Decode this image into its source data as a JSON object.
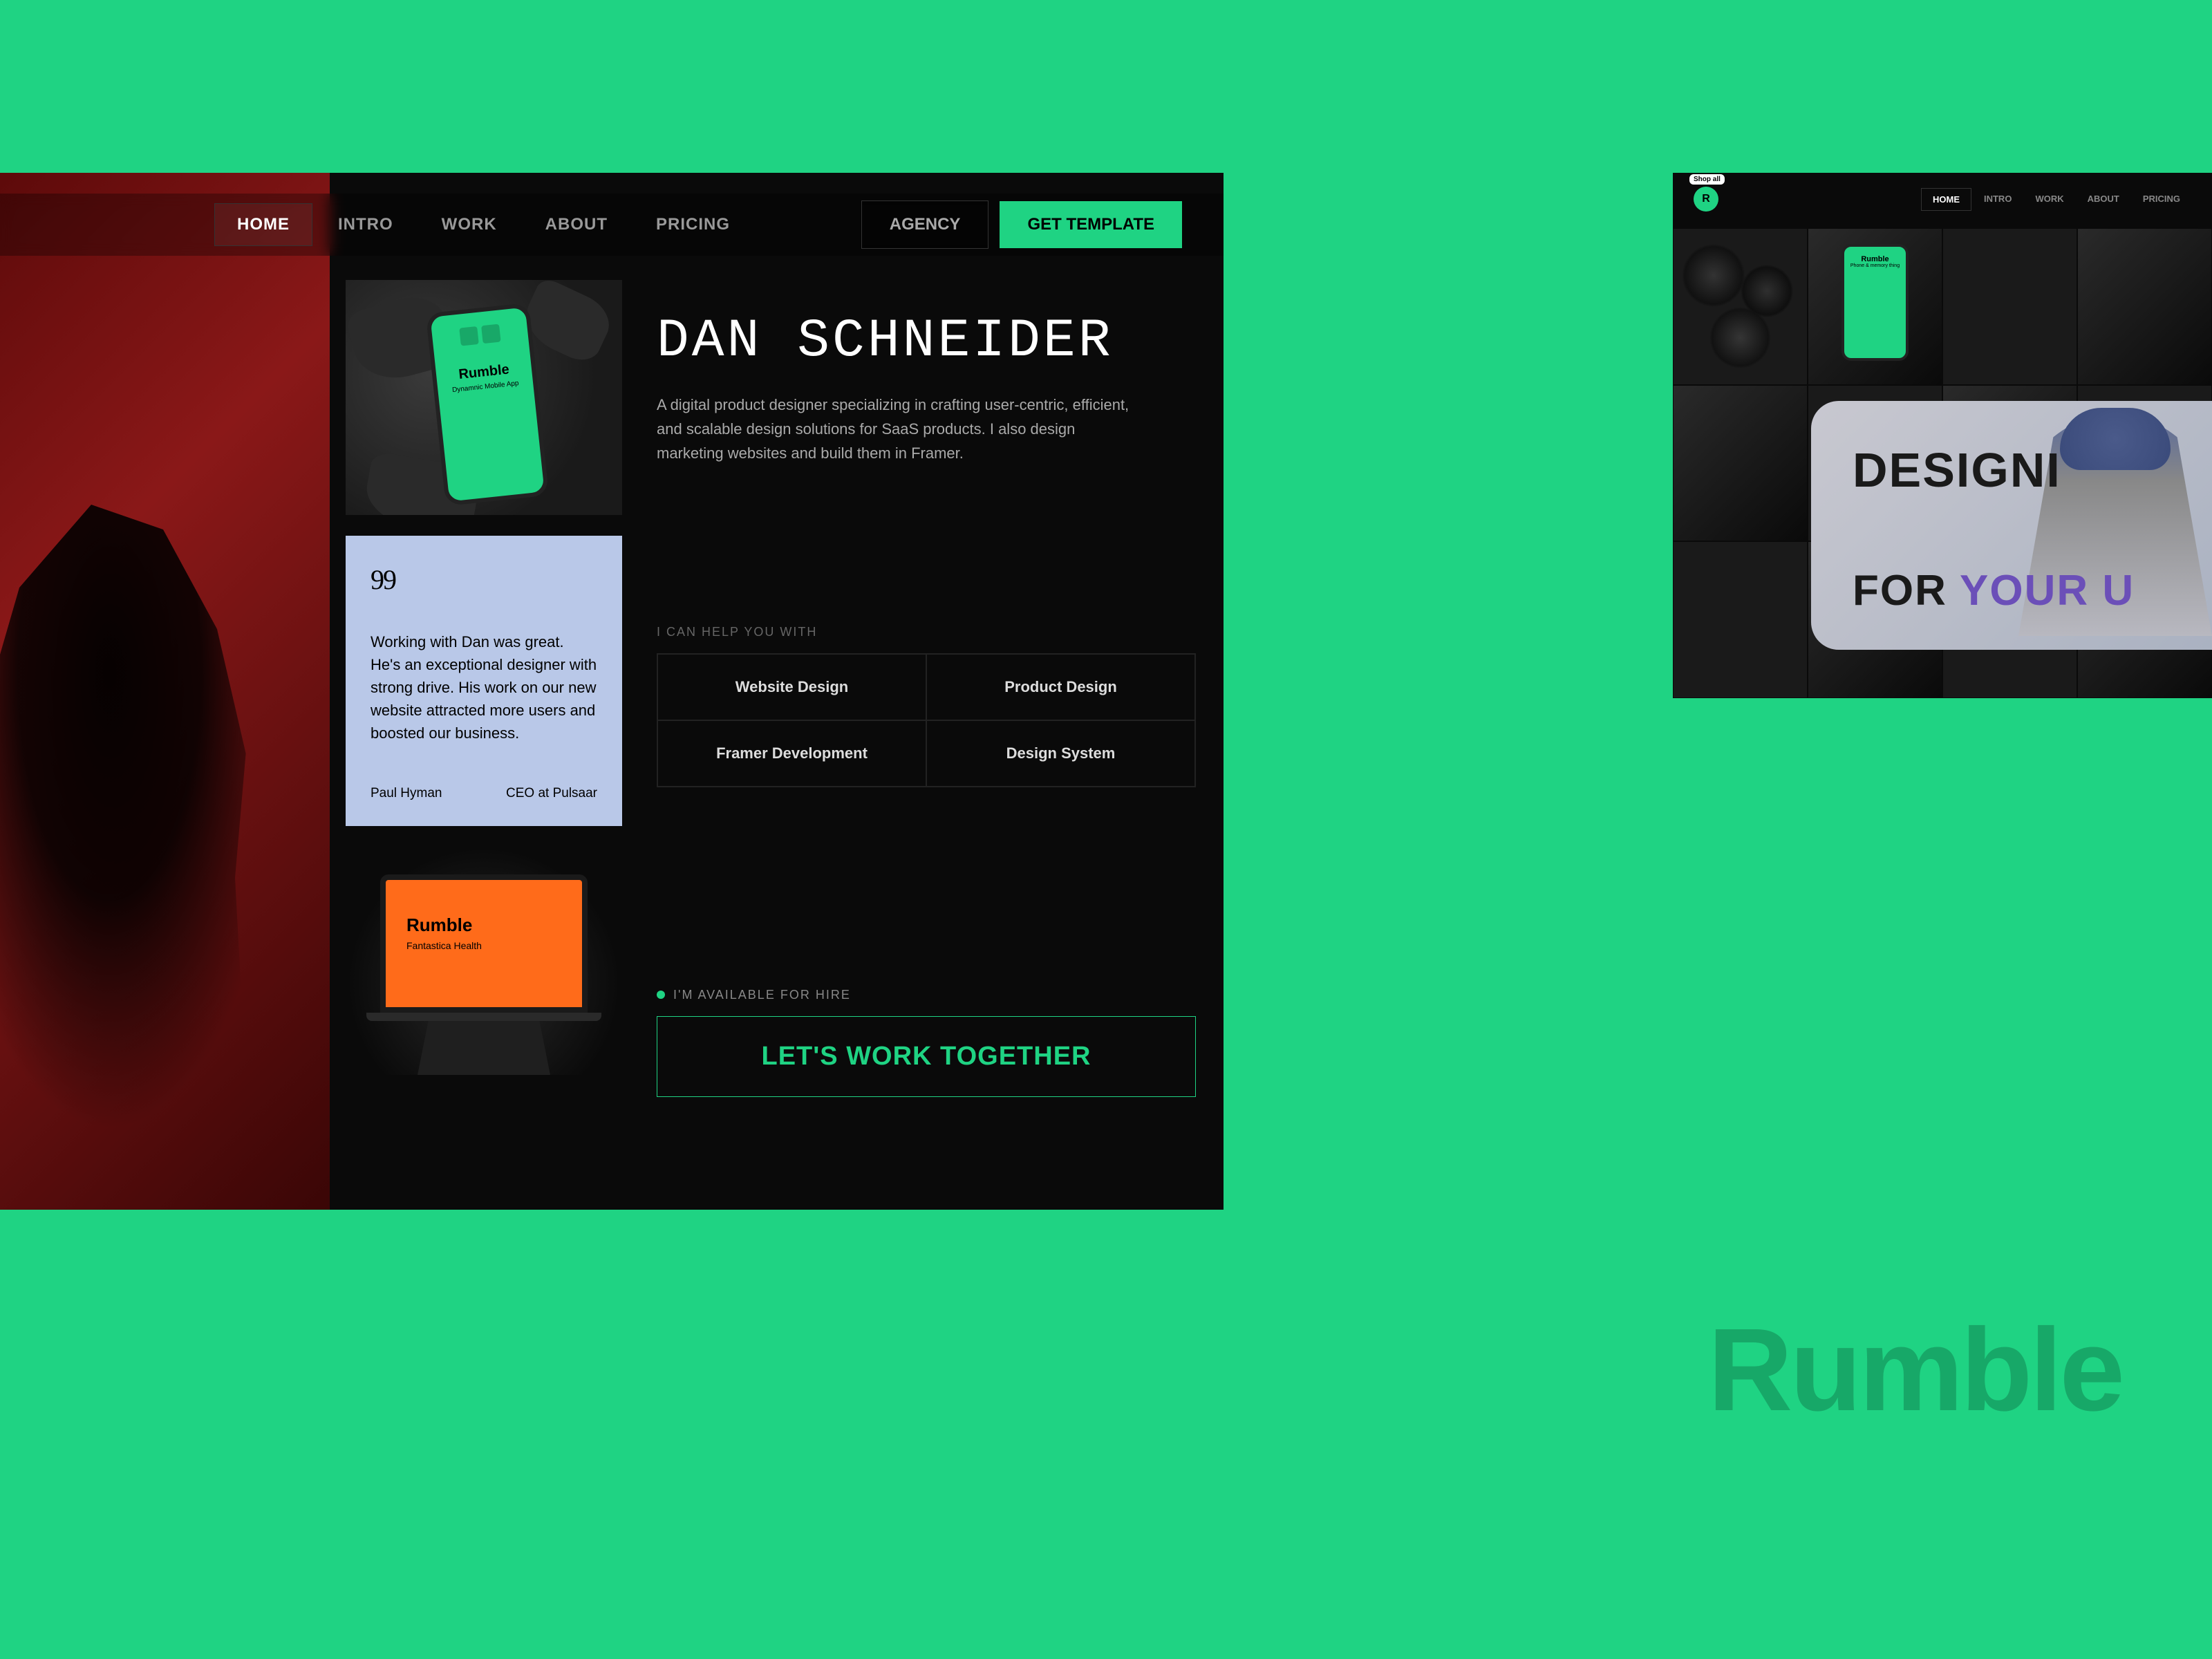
{
  "brand": "Rumble",
  "nav": {
    "tabs": [
      "HOME",
      "INTRO",
      "WORK",
      "ABOUT",
      "PRICING"
    ],
    "active": "HOME",
    "agency": "AGENCY",
    "cta": "GET TEMPLATE"
  },
  "hero": {
    "name": "DAN SCHNEIDER",
    "desc": "A digital product designer specializing in crafting user-centric, efficient, and scalable design solutions for SaaS products. I also design marketing websites and build them in Framer."
  },
  "services": {
    "label": "I CAN HELP YOU WITH",
    "items": [
      "Website Design",
      "Product Design",
      "Framer Development",
      "Design System"
    ]
  },
  "availability": {
    "label": "I'M AVAILABLE FOR HIRE",
    "cta": "LET'S WORK TOGETHER"
  },
  "testimonial": {
    "quote_glyph": "99",
    "text": "Working with Dan was great. He's an exceptional designer with strong drive. His work on our new website attracted more users and boosted our business.",
    "author": "Paul Hyman",
    "role": "CEO at Pulsaar"
  },
  "phone_mock": {
    "brand": "Rumble",
    "sub": "Dynamnic Mobile App"
  },
  "laptop_mock": {
    "brand": "Rumble",
    "sub": "Fantastica Health"
  },
  "small": {
    "badge": "R",
    "badge_label": "Shop all",
    "tabs": [
      "HOME",
      "INTRO",
      "WORK",
      "ABOUT",
      "PRICING"
    ],
    "overlay_line1": "DESIGNI",
    "overlay_line2_pre": "FOR ",
    "overlay_line2_accent": "YOUR U",
    "phone_brand": "Rumble",
    "phone_sub": "Phone & memory thing"
  },
  "colors": {
    "bg": "#1fd383",
    "accent": "#1fd383",
    "testimonial_bg": "#b9c8e8",
    "laptop_screen": "#ff6b1a"
  }
}
